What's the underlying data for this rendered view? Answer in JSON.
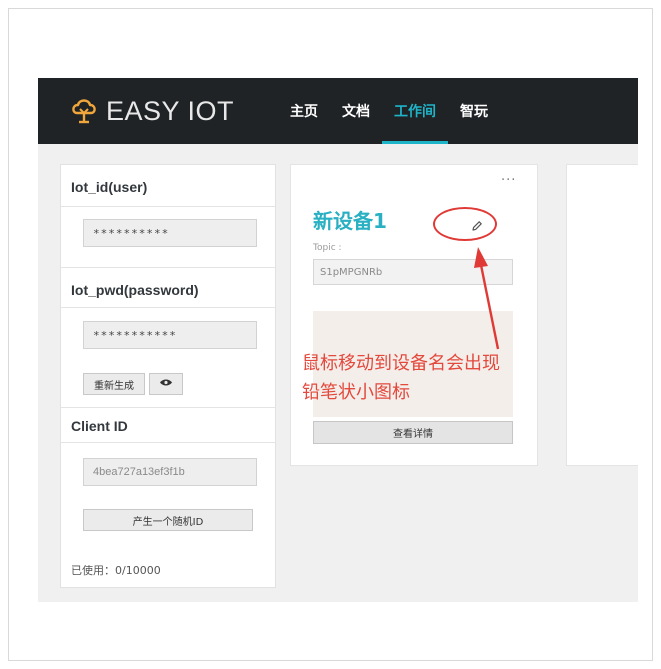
{
  "app": {
    "logo_text": "EASY IOT",
    "logo_icon": "cloud-bulb-icon"
  },
  "nav": [
    {
      "label": "主页",
      "active": false
    },
    {
      "label": "文档",
      "active": false
    },
    {
      "label": "工作间",
      "active": true
    },
    {
      "label": "智玩",
      "active": false
    }
  ],
  "sidebar": {
    "user_title": "Iot_id(user)",
    "user_value": "**********",
    "pwd_title": "Iot_pwd(password)",
    "pwd_value": "***********",
    "regenerate_label": "重新生成",
    "show_icon": "eye-icon",
    "client_title": "Client ID",
    "client_value": "4bea727a13ef3f1b",
    "random_id_label": "产生一个随机ID",
    "used_text": "已使用：0/10000"
  },
  "device_card": {
    "more_label": "···",
    "name": "新设备1",
    "edit_icon": "pencil-icon",
    "topic_label": "Topic :",
    "topic_value": "S1pMPGNRb",
    "detail_label": "查看详情"
  },
  "annotation": {
    "line1": "鼠标移动到设备名会出现",
    "line2": "铅笔状小图标"
  },
  "colors": {
    "accent": "#1fb5c9",
    "topbar": "#1f2326",
    "logo": "#f0a63a",
    "annotation": "#e3493d"
  }
}
